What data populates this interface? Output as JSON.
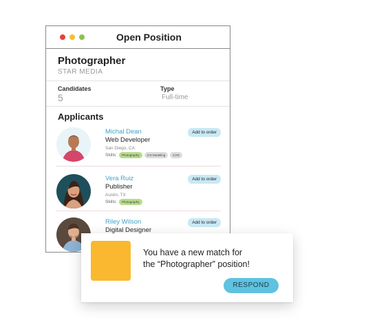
{
  "window": {
    "title": "Open Position",
    "dots": [
      "#ee3d3d",
      "#f5c02c",
      "#8bc34a"
    ]
  },
  "job": {
    "title": "Photographer",
    "company": "STAR MEDIA"
  },
  "meta": {
    "candidates_label": "Candidates",
    "candidates_value": "5",
    "type_label": "Type",
    "type_value": "Full-time"
  },
  "applicants": {
    "heading": "Applicants",
    "items": [
      {
        "name": "Michal Dean",
        "role": "Web Developer",
        "location": "San Diego, CA",
        "skills_label": "Skills:",
        "skills": [
          "Photography",
          "3-D Modeling",
          "CAD"
        ],
        "button": "Add to order"
      },
      {
        "name": "Vera Ruiz",
        "role": "Publisher",
        "location": "Austin, TX",
        "skills_label": "Skills:",
        "skills": [
          "Photography"
        ],
        "button": "Add to order"
      },
      {
        "name": "Riley Wilson",
        "role": "Digital Designer",
        "location": "",
        "skills_label": "",
        "skills": [],
        "button": "Add to order"
      }
    ]
  },
  "notification": {
    "line1": "You have a new match for",
    "line2": "the “Photographer” position!",
    "button": "RESPOND",
    "accent": "#f9b82f"
  }
}
